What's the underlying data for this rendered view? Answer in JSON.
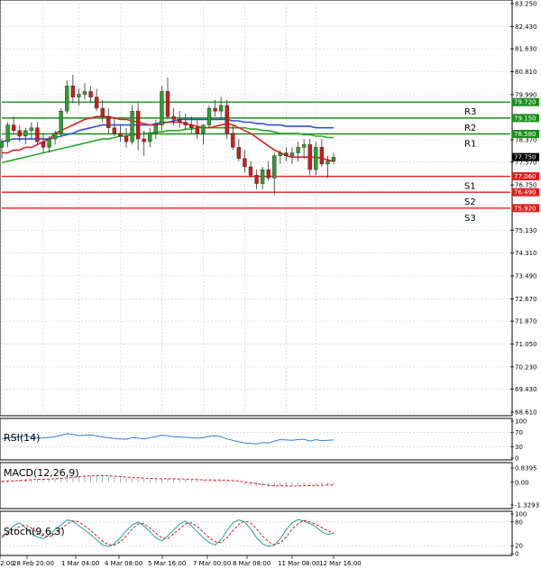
{
  "chart_data": {
    "type": "candlestick",
    "main": {
      "ylim": [
        68.61,
        83.25
      ],
      "y_ticks": [
        "83.250",
        "82.430",
        "81.630",
        "80.810",
        "79.990",
        "78.370",
        "77.570",
        "76.750",
        "75.130",
        "74.310",
        "73.490",
        "72.670",
        "71.870",
        "71.050",
        "70.230",
        "69.430",
        "68.610"
      ],
      "x_ticks": [
        "2:00",
        "28 Feb 20:00",
        "1 Mar 04:00",
        "4 Mar 08:00",
        "5 Mar 16:00",
        "7 Mar 00:00",
        "8 Mar 08:00",
        "11 Mar 08:00",
        "12 Mar 16:00"
      ],
      "current_price": "77.750",
      "colors": {
        "up": "#2e9e2e",
        "down": "#d21919",
        "resistance": "#1b8f1b",
        "support": "#e01e1e",
        "ma_fast": "#e02020",
        "ma_mid": "#3050d0",
        "ma_slow": "#2aa82a",
        "grid": "#c8c8c8"
      },
      "levels": [
        {
          "name": "R3",
          "value": "79.720",
          "kind": "resistance"
        },
        {
          "name": "R2",
          "value": "79.150",
          "kind": "resistance"
        },
        {
          "name": "R1",
          "value": "78.580",
          "kind": "resistance"
        },
        {
          "name": "S1",
          "value": "77.060",
          "kind": "support"
        },
        {
          "name": "S2",
          "value": "76.490",
          "kind": "support"
        },
        {
          "name": "S3",
          "value": "75.920",
          "kind": "support"
        }
      ],
      "candles": [
        [
          0,
          78.1,
          78.4,
          77.7,
          78.3
        ],
        [
          1,
          78.3,
          79.0,
          78.1,
          78.9
        ],
        [
          2,
          78.9,
          79.2,
          78.6,
          78.7
        ],
        [
          3,
          78.7,
          78.9,
          78.3,
          78.5
        ],
        [
          4,
          78.5,
          78.8,
          78.2,
          78.7
        ],
        [
          5,
          78.7,
          79.0,
          78.4,
          78.8
        ],
        [
          6,
          78.8,
          79.0,
          78.2,
          78.3
        ],
        [
          7,
          78.3,
          78.6,
          77.9,
          78.1
        ],
        [
          8,
          78.1,
          78.5,
          77.9,
          78.4
        ],
        [
          9,
          78.4,
          78.7,
          78.2,
          78.6
        ],
        [
          10,
          78.6,
          79.5,
          78.5,
          79.4
        ],
        [
          11,
          79.4,
          80.5,
          79.3,
          80.3
        ],
        [
          12,
          80.3,
          80.7,
          79.7,
          79.9
        ],
        [
          13,
          79.9,
          80.2,
          79.6,
          80.0
        ],
        [
          14,
          80.0,
          80.4,
          79.8,
          80.1
        ],
        [
          15,
          80.1,
          80.3,
          79.7,
          79.9
        ],
        [
          16,
          79.9,
          80.2,
          79.4,
          79.5
        ],
        [
          17,
          79.5,
          79.8,
          79.0,
          79.2
        ],
        [
          18,
          79.2,
          79.5,
          78.6,
          78.8
        ],
        [
          19,
          78.8,
          79.2,
          78.5,
          78.6
        ],
        [
          20,
          78.6,
          78.9,
          78.3,
          78.5
        ],
        [
          21,
          78.5,
          78.8,
          78.1,
          78.3
        ],
        [
          22,
          78.3,
          79.6,
          78.2,
          79.4
        ],
        [
          23,
          79.4,
          79.7,
          78.0,
          78.4
        ],
        [
          24,
          78.4,
          78.7,
          77.8,
          78.3
        ],
        [
          25,
          78.3,
          78.8,
          78.1,
          78.6
        ],
        [
          26,
          78.6,
          79.1,
          78.4,
          78.9
        ],
        [
          27,
          78.9,
          80.3,
          78.7,
          80.1
        ],
        [
          28,
          80.1,
          80.6,
          79.1,
          79.2
        ],
        [
          29,
          79.2,
          79.5,
          78.9,
          79.1
        ],
        [
          30,
          79.1,
          79.4,
          78.8,
          79.0
        ],
        [
          31,
          79.0,
          79.3,
          78.7,
          78.9
        ],
        [
          32,
          78.9,
          79.2,
          78.6,
          78.8
        ],
        [
          33,
          78.8,
          79.1,
          78.4,
          78.6
        ],
        [
          34,
          78.6,
          78.9,
          78.2,
          78.9
        ],
        [
          35,
          78.9,
          79.6,
          78.8,
          79.5
        ],
        [
          36,
          79.5,
          79.8,
          79.2,
          79.4
        ],
        [
          37,
          79.4,
          79.9,
          79.1,
          79.6
        ],
        [
          38,
          79.6,
          79.8,
          78.4,
          78.6
        ],
        [
          39,
          78.6,
          78.9,
          78.0,
          78.1
        ],
        [
          40,
          78.1,
          78.4,
          77.6,
          77.7
        ],
        [
          41,
          77.7,
          78.0,
          77.2,
          77.4
        ],
        [
          42,
          77.4,
          77.6,
          77.0,
          77.1
        ],
        [
          43,
          77.1,
          77.3,
          76.6,
          76.8
        ],
        [
          44,
          76.8,
          77.4,
          76.6,
          77.3
        ],
        [
          45,
          77.3,
          77.6,
          76.9,
          77.0
        ],
        [
          46,
          77.0,
          77.9,
          76.4,
          77.8
        ],
        [
          47,
          77.8,
          78.0,
          77.5,
          77.9
        ],
        [
          48,
          77.9,
          78.1,
          77.6,
          77.8
        ],
        [
          49,
          77.8,
          78.1,
          77.5,
          77.9
        ],
        [
          50,
          77.9,
          78.3,
          77.6,
          78.1
        ],
        [
          51,
          78.1,
          78.4,
          77.7,
          78.2
        ],
        [
          52,
          78.2,
          78.4,
          77.1,
          77.3
        ],
        [
          53,
          77.3,
          78.3,
          77.1,
          78.1
        ],
        [
          54,
          78.1,
          78.4,
          77.4,
          77.5
        ],
        [
          55,
          77.5,
          77.8,
          77.0,
          77.6
        ],
        [
          56,
          77.6,
          77.9,
          77.5,
          77.75
        ]
      ],
      "ma_fast": [
        77.9,
        77.9,
        78.0,
        78.0,
        78.1,
        78.1,
        78.2,
        78.3,
        78.4,
        78.6,
        78.7,
        78.8,
        78.9,
        79.0,
        79.1,
        79.15,
        79.2,
        79.2,
        79.2,
        79.15,
        79.1,
        79.1,
        79.05,
        79.0,
        78.95,
        78.9,
        78.9,
        78.95,
        79.0,
        79.0,
        79.0,
        78.95,
        78.9,
        78.85,
        78.8,
        78.8,
        78.85,
        78.9,
        78.95,
        78.9,
        78.8,
        78.7,
        78.6,
        78.45,
        78.3,
        78.15,
        78.0,
        77.9,
        77.8,
        77.75,
        77.75,
        77.75,
        77.75,
        77.75,
        77.7,
        77.65,
        77.6
      ],
      "ma_mid": [
        78.3,
        78.35,
        78.4,
        78.4,
        78.4,
        78.4,
        78.4,
        78.4,
        78.4,
        78.45,
        78.5,
        78.55,
        78.6,
        78.7,
        78.75,
        78.8,
        78.85,
        78.9,
        78.9,
        78.9,
        78.9,
        78.9,
        78.9,
        78.9,
        78.9,
        78.9,
        78.95,
        79.0,
        79.0,
        79.05,
        79.1,
        79.1,
        79.1,
        79.1,
        79.1,
        79.1,
        79.1,
        79.1,
        79.1,
        79.05,
        79.05,
        79.0,
        79.0,
        78.95,
        78.95,
        78.9,
        78.9,
        78.9,
        78.85,
        78.85,
        78.85,
        78.85,
        78.85,
        78.8,
        78.8,
        78.8,
        78.8
      ],
      "ma_slow": [
        77.55,
        77.6,
        77.65,
        77.7,
        77.75,
        77.8,
        77.85,
        77.9,
        77.95,
        78.0,
        78.05,
        78.1,
        78.15,
        78.2,
        78.25,
        78.3,
        78.35,
        78.4,
        78.4,
        78.45,
        78.5,
        78.5,
        78.55,
        78.55,
        78.6,
        78.6,
        78.65,
        78.65,
        78.7,
        78.7,
        78.7,
        78.75,
        78.75,
        78.8,
        78.8,
        78.8,
        78.8,
        78.8,
        78.8,
        78.8,
        78.8,
        78.8,
        78.75,
        78.75,
        78.7,
        78.7,
        78.65,
        78.6,
        78.6,
        78.6,
        78.6,
        78.55,
        78.55,
        78.5,
        78.5,
        78.45,
        78.45
      ]
    },
    "rsi": {
      "label": "RSI(14)",
      "levels": [
        "100",
        "70",
        "30",
        "0"
      ],
      "values": [
        52,
        54,
        56,
        58,
        60,
        57,
        55,
        54,
        56,
        58,
        62,
        66,
        64,
        61,
        62,
        63,
        60,
        57,
        55,
        53,
        52,
        51,
        55,
        54,
        52,
        55,
        58,
        62,
        60,
        58,
        57,
        56,
        55,
        54,
        55,
        59,
        60,
        58,
        52,
        48,
        44,
        41,
        40,
        38,
        42,
        41,
        46,
        50,
        49,
        48,
        50,
        51,
        46,
        50,
        47,
        48,
        49
      ]
    },
    "macd": {
      "label": "MACD(12,26,9)",
      "ticks": [
        "0.8395",
        "0.00",
        "-1.3293"
      ],
      "ylim": [
        -1.3293,
        0.8395
      ],
      "hist": [
        0.1,
        0.12,
        0.14,
        0.15,
        0.17,
        0.18,
        0.19,
        0.2,
        0.21,
        0.23,
        0.26,
        0.32,
        0.36,
        0.38,
        0.4,
        0.41,
        0.4,
        0.38,
        0.35,
        0.31,
        0.28,
        0.25,
        0.24,
        0.22,
        0.2,
        0.19,
        0.19,
        0.21,
        0.22,
        0.2,
        0.18,
        0.16,
        0.14,
        0.12,
        0.11,
        0.12,
        0.13,
        0.12,
        0.08,
        0.02,
        -0.05,
        -0.12,
        -0.18,
        -0.22,
        -0.25,
        -0.26,
        -0.25,
        -0.23,
        -0.21,
        -0.19,
        -0.17,
        -0.16,
        -0.17,
        -0.16,
        -0.15,
        -0.14,
        -0.13
      ],
      "signal": [
        0.05,
        0.07,
        0.09,
        0.11,
        0.13,
        0.15,
        0.17,
        0.18,
        0.19,
        0.21,
        0.23,
        0.26,
        0.3,
        0.33,
        0.36,
        0.38,
        0.39,
        0.39,
        0.38,
        0.36,
        0.34,
        0.31,
        0.29,
        0.27,
        0.25,
        0.23,
        0.22,
        0.21,
        0.21,
        0.21,
        0.2,
        0.19,
        0.17,
        0.16,
        0.14,
        0.14,
        0.13,
        0.13,
        0.12,
        0.1,
        0.06,
        0.02,
        -0.03,
        -0.08,
        -0.13,
        -0.17,
        -0.2,
        -0.21,
        -0.22,
        -0.22,
        -0.21,
        -0.2,
        -0.19,
        -0.18,
        -0.17,
        -0.16,
        -0.15
      ]
    },
    "stoch": {
      "label": "Stoch(9,6,3)",
      "levels": [
        "100",
        "80",
        "20",
        "0"
      ],
      "k": [
        40,
        55,
        70,
        78,
        65,
        50,
        42,
        38,
        48,
        60,
        72,
        85,
        82,
        70,
        60,
        48,
        35,
        22,
        18,
        25,
        40,
        58,
        72,
        80,
        70,
        55,
        40,
        32,
        45,
        60,
        75,
        82,
        70,
        55,
        40,
        28,
        22,
        35,
        58,
        78,
        85,
        80,
        62,
        40,
        25,
        18,
        22,
        38,
        60,
        78,
        86,
        82,
        76,
        68,
        55,
        48,
        52
      ],
      "d": [
        45,
        48,
        58,
        68,
        72,
        65,
        52,
        44,
        42,
        50,
        62,
        75,
        82,
        80,
        70,
        58,
        45,
        32,
        22,
        22,
        30,
        45,
        62,
        75,
        76,
        65,
        52,
        40,
        38,
        50,
        62,
        75,
        78,
        68,
        55,
        40,
        30,
        28,
        40,
        58,
        74,
        82,
        78,
        62,
        45,
        30,
        22,
        28,
        42,
        62,
        76,
        84,
        80,
        74,
        66,
        58,
        52
      ]
    }
  }
}
